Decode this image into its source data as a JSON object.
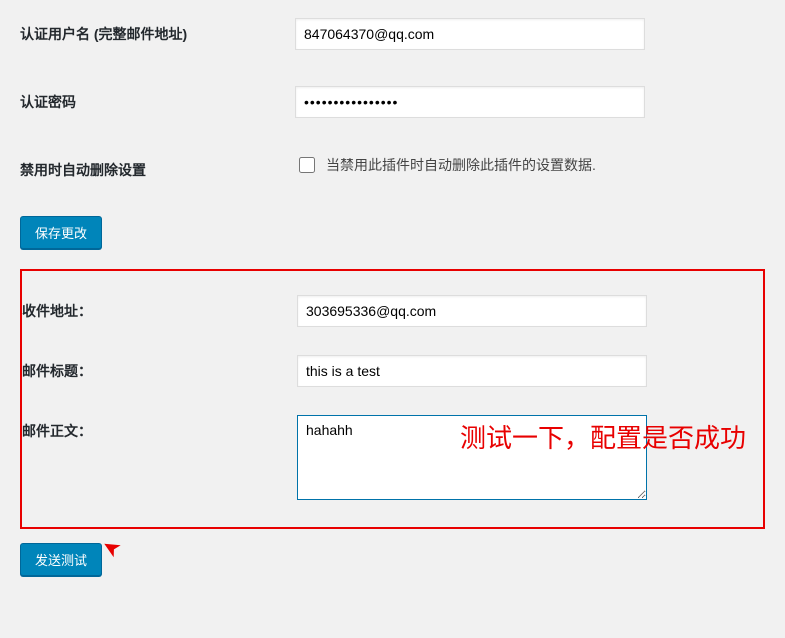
{
  "settings": {
    "username_label": "认证用户名 (完整邮件地址)",
    "username_value": "847064370@qq.com",
    "password_label": "认证密码",
    "password_value": "••••••••••••••••",
    "auto_delete_label": "禁用时自动删除设置",
    "auto_delete_desc": "当禁用此插件时自动删除此插件的设置数据.",
    "save_button": "保存更改"
  },
  "test": {
    "recipient_label": "收件地址：",
    "recipient_value": "303695336@qq.com",
    "subject_label": "邮件标题：",
    "subject_value": "this is a test",
    "body_label": "邮件正文：",
    "body_value": "hahahh",
    "send_button": "发送测试",
    "annotation": "测试一下，配置是否成功"
  }
}
